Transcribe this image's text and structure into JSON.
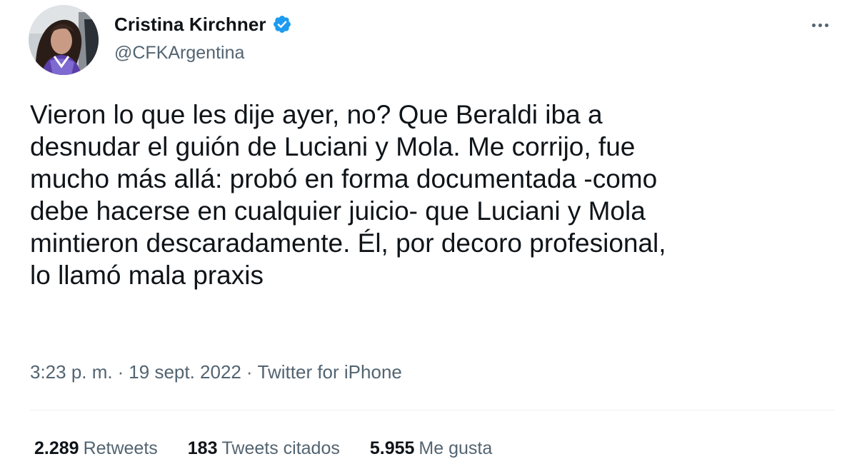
{
  "author": {
    "display_name": "Cristina Kirchner",
    "handle": "@CFKArgentina",
    "verified": true
  },
  "icons": {
    "verified": "verified-badge-icon",
    "more": "more-options-icon"
  },
  "colors": {
    "verified": "#1d9bf0",
    "secondary_text": "#536471",
    "primary_text": "#0f1419"
  },
  "tweet": {
    "text": "Vieron lo que les dije ayer, no? Que Beraldi iba a\ndesnudar el guión de Luciani y Mola. Me corrijo, fue\nmucho más allá: probó en forma documentada -como\ndebe hacerse en cualquier juicio- que Luciani y Mola\nmintieron descaradamente. Él, por decoro profesional,\nlo llamó mala praxis",
    "time": "3:23 p. m.",
    "date": "19 sept. 2022",
    "source": "Twitter for iPhone",
    "separator": "·"
  },
  "stats": {
    "retweets": {
      "count": "2.289",
      "label": "Retweets"
    },
    "quotes": {
      "count": "183",
      "label": "Tweets citados"
    },
    "likes": {
      "count": "5.955",
      "label": "Me gusta"
    }
  }
}
